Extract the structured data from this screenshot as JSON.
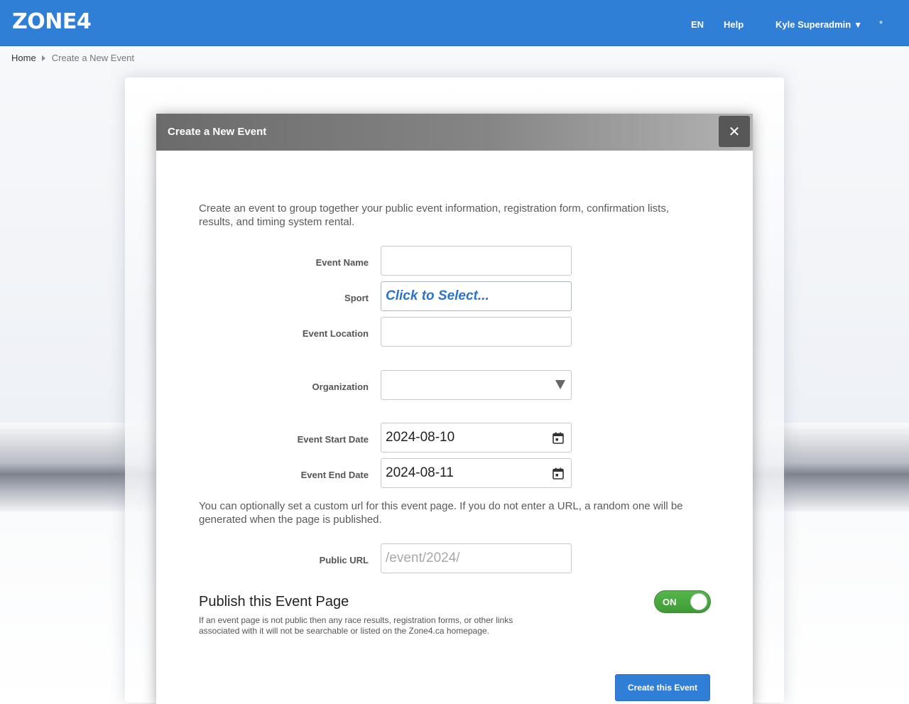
{
  "header": {
    "logo": "ZONE4",
    "lang": "EN",
    "help": "Help",
    "user": "Kyle Superadmin",
    "user_caret": "▼",
    "star": "*"
  },
  "breadcrumb": {
    "home": "Home",
    "current": "Create a New Event"
  },
  "modal": {
    "title": "Create a New Event",
    "close": "✕",
    "intro": "Create an event to group together your public event information, registration form, confirmation lists, results, and timing system rental.",
    "fields": {
      "event_name": {
        "label": "Event Name",
        "value": ""
      },
      "sport": {
        "label": "Sport",
        "value": "Click to Select..."
      },
      "event_location": {
        "label": "Event Location",
        "value": ""
      },
      "organization": {
        "label": "Organization",
        "value": ""
      },
      "start_date": {
        "label": "Event Start Date",
        "value": "2024-08-10"
      },
      "end_date": {
        "label": "Event End Date",
        "value": "2024-08-11"
      }
    },
    "url_intro": "You can optionally set a custom url for this event page. If you do not enter a URL, a random one will be generated when the page is published.",
    "public_url": {
      "label": "Public URL",
      "placeholder": "/event/2024/"
    },
    "publish": {
      "title": "Publish this Event Page",
      "description": "If an event page is not public then any race results, registration forms, or other links associated with it will not be searchable or listed on the Zone4.ca homepage.",
      "toggle": "ON"
    },
    "submit": "Create this Event"
  },
  "colors": {
    "brand_blue": "#2f7fd6",
    "toggle_green": "#4aa83f"
  }
}
